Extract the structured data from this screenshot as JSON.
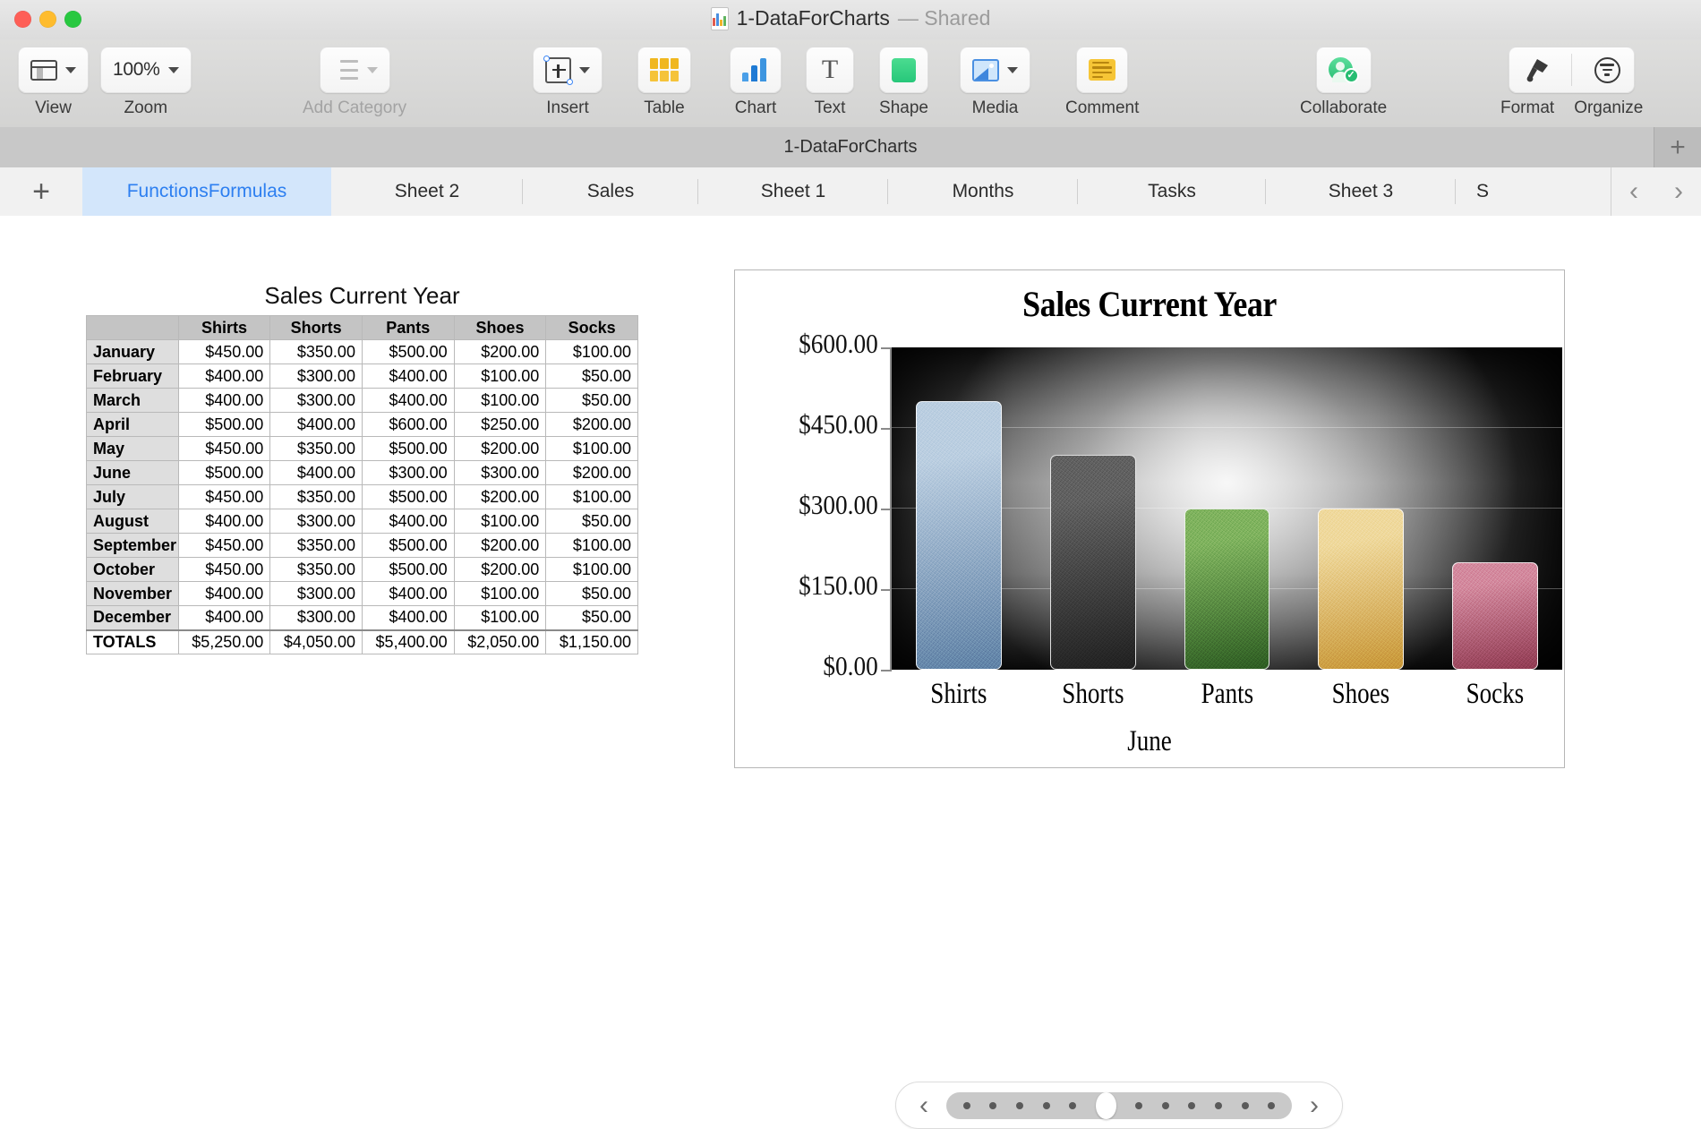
{
  "window": {
    "title": "1-DataForCharts",
    "shared_label": "— Shared",
    "doc_icon": "chart-document-icon"
  },
  "toolbar": {
    "items": [
      {
        "label": "View",
        "icon": "view-layout-icon",
        "dimmed": false
      },
      {
        "label": "Zoom",
        "icon": "zoom-percent-icon",
        "value": "100%",
        "dimmed": false
      },
      {
        "label": "Add Category",
        "icon": "bulleted-list-icon",
        "dimmed": true
      },
      {
        "label": "Insert",
        "icon": "insert-plus-icon",
        "dimmed": false
      },
      {
        "label": "Table",
        "icon": "table-grid-icon",
        "dimmed": false
      },
      {
        "label": "Chart",
        "icon": "bar-chart-icon",
        "dimmed": false
      },
      {
        "label": "Text",
        "icon": "text-t-icon",
        "dimmed": false
      },
      {
        "label": "Shape",
        "icon": "shape-square-icon",
        "dimmed": false
      },
      {
        "label": "Media",
        "icon": "media-photo-icon",
        "dimmed": false
      },
      {
        "label": "Comment",
        "icon": "comment-note-icon",
        "dimmed": false
      },
      {
        "label": "Collaborate",
        "icon": "collaborate-person-check-icon",
        "dimmed": false
      },
      {
        "label": "Format",
        "icon": "format-paintbrush-icon",
        "dimmed": false
      },
      {
        "label": "Organize",
        "icon": "organize-filter-icon",
        "dimmed": false
      }
    ]
  },
  "sheet_strip": {
    "name": "1-DataForCharts",
    "add_sheet": "+"
  },
  "tabs": {
    "add_label": "+",
    "items": [
      {
        "label": "FunctionsFormulas",
        "active": true
      },
      {
        "label": "Sheet 2",
        "active": false
      },
      {
        "label": "Sales",
        "active": false
      },
      {
        "label": "Sheet 1",
        "active": false
      },
      {
        "label": "Months",
        "active": false
      },
      {
        "label": "Tasks",
        "active": false
      },
      {
        "label": "Sheet 3",
        "active": false
      },
      {
        "label": "S",
        "active": false
      }
    ],
    "prev": "‹",
    "next": "›"
  },
  "table": {
    "title": "Sales Current Year",
    "columns": [
      "",
      "Shirts",
      "Shorts",
      "Pants",
      "Shoes",
      "Socks"
    ],
    "rows": [
      {
        "label": "January",
        "values": [
          "$450.00",
          "$350.00",
          "$500.00",
          "$200.00",
          "$100.00"
        ]
      },
      {
        "label": "February",
        "values": [
          "$400.00",
          "$300.00",
          "$400.00",
          "$100.00",
          "$50.00"
        ]
      },
      {
        "label": "March",
        "values": [
          "$400.00",
          "$300.00",
          "$400.00",
          "$100.00",
          "$50.00"
        ]
      },
      {
        "label": "April",
        "values": [
          "$500.00",
          "$400.00",
          "$600.00",
          "$250.00",
          "$200.00"
        ]
      },
      {
        "label": "May",
        "values": [
          "$450.00",
          "$350.00",
          "$500.00",
          "$200.00",
          "$100.00"
        ]
      },
      {
        "label": "June",
        "values": [
          "$500.00",
          "$400.00",
          "$300.00",
          "$300.00",
          "$200.00"
        ]
      },
      {
        "label": "July",
        "values": [
          "$450.00",
          "$350.00",
          "$500.00",
          "$200.00",
          "$100.00"
        ]
      },
      {
        "label": "August",
        "values": [
          "$400.00",
          "$300.00",
          "$400.00",
          "$100.00",
          "$50.00"
        ]
      },
      {
        "label": "September",
        "values": [
          "$450.00",
          "$350.00",
          "$500.00",
          "$200.00",
          "$100.00"
        ]
      },
      {
        "label": "October",
        "values": [
          "$450.00",
          "$350.00",
          "$500.00",
          "$200.00",
          "$100.00"
        ]
      },
      {
        "label": "November",
        "values": [
          "$400.00",
          "$300.00",
          "$400.00",
          "$100.00",
          "$50.00"
        ]
      },
      {
        "label": "December",
        "values": [
          "$400.00",
          "$300.00",
          "$400.00",
          "$100.00",
          "$50.00"
        ]
      }
    ],
    "totals": {
      "label": "TOTALS",
      "values": [
        "$5,250.00",
        "$4,050.00",
        "$5,400.00",
        "$2,050.00",
        "$1,150.00"
      ]
    }
  },
  "chart_data": {
    "type": "bar",
    "title": "Sales Current Year",
    "xlabel": "June",
    "ylabel": "",
    "categories": [
      "Shirts",
      "Shorts",
      "Pants",
      "Shoes",
      "Socks"
    ],
    "values": [
      500,
      400,
      300,
      300,
      200
    ],
    "ylim": [
      0,
      600
    ],
    "yticks": [
      0,
      150,
      300,
      450,
      600
    ],
    "ytick_labels": [
      "$0.00",
      "$150.00",
      "$300.00",
      "$450.00",
      "$600.00"
    ],
    "grid": true,
    "legend": "none",
    "bar_colors": [
      "#8aa6c4",
      "#4a4a4a",
      "#4f8a3d",
      "#dcb254",
      "#b8596e"
    ],
    "series": [
      {
        "name": "June",
        "values": [
          500,
          400,
          300,
          300,
          200
        ]
      }
    ]
  },
  "pager": {
    "prev": "‹",
    "next": "›",
    "total_dots": 12,
    "active_index": 5
  }
}
